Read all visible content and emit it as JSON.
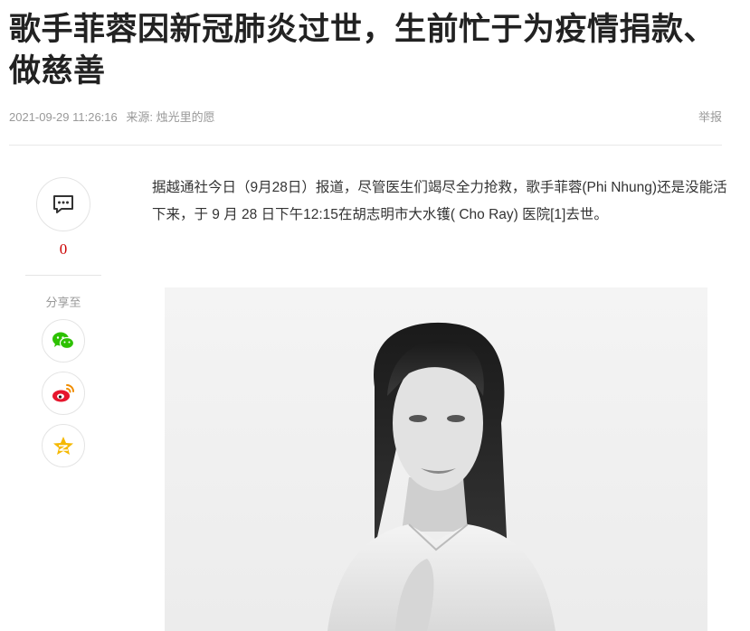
{
  "article": {
    "title": "歌手菲蓉因新冠肺炎过世，生前忙于为疫情捐款、做慈善",
    "timestamp": "2021-09-29 11:26:16",
    "source": "来源: 烛光里的愿",
    "report_label": "举报",
    "paragraph": "据越通社今日（9月28日）报道，尽管医生们竭尽全力抢救，歌手菲蓉(Phi Nhung)还是没能活下来，于 9 月 28 日下午12:15在胡志明市大水镬( Cho Ray) 医院[1]去世。"
  },
  "sidebar": {
    "comment_count": "0",
    "share_label": "分享至",
    "share_icons": [
      "wechat-icon",
      "weibo-icon",
      "qzone-icon"
    ]
  },
  "colors": {
    "accent": "#cc0000",
    "wechat": "#2dc100",
    "weibo": "#e6162d",
    "qzone": "#f5b800"
  }
}
